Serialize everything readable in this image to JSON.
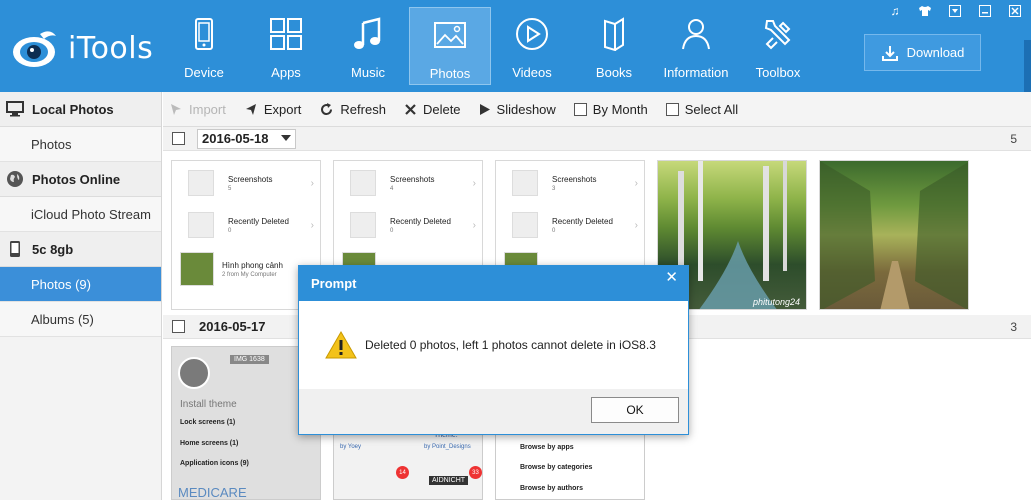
{
  "app": {
    "name": "iTools"
  },
  "nav": [
    {
      "label": "Device",
      "icon": "phone-icon"
    },
    {
      "label": "Apps",
      "icon": "apps-grid-icon"
    },
    {
      "label": "Music",
      "icon": "music-note-icon"
    },
    {
      "label": "Photos",
      "icon": "photo-icon",
      "active": true
    },
    {
      "label": "Videos",
      "icon": "play-circle-icon"
    },
    {
      "label": "Books",
      "icon": "book-icon"
    },
    {
      "label": "Information",
      "icon": "person-icon"
    },
    {
      "label": "Toolbox",
      "icon": "wrench-icon"
    }
  ],
  "header": {
    "download_label": "Download"
  },
  "sidebar": {
    "local_photos": "Local Photos",
    "photos": "Photos",
    "photos_online": "Photos Online",
    "icloud": "iCloud Photo Stream",
    "device": "5c 8gb",
    "device_photos": "Photos (9)",
    "albums": "Albums (5)"
  },
  "toolbar": {
    "import": "Import",
    "export": "Export",
    "refresh": "Refresh",
    "delete": "Delete",
    "slideshow": "Slideshow",
    "by_month": "By Month",
    "select_all": "Select All"
  },
  "groups": [
    {
      "date": "2016-05-18",
      "count": "5"
    },
    {
      "date": "2016-05-17",
      "count": "3"
    }
  ],
  "thumbs": {
    "screenshots": "Screenshots",
    "recently_deleted": "Recently Deleted",
    "counts": [
      "5",
      "4",
      "3"
    ],
    "deleted_count": "0",
    "album_name": "Hình phong cảnh",
    "album_sub": "2 from My Computer",
    "watermark": "phitutong24",
    "tall1_header": "IMG 1638",
    "tall1_install": "Install theme",
    "tall1_lock": "Lock screens (1)",
    "tall1_home": "Home screens (1)",
    "tall1_appicons": "Application icons (9)",
    "tall1_footer": "MEDICARE",
    "tall2_by": "by Yoey",
    "tall2_theme": "Theme.",
    "tall2_by2": "by Point_Designs",
    "badge1": "14",
    "badge2": "33",
    "tall2_word": "AIDNICHT",
    "tall3_apps": "Browse by apps",
    "tall3_cats": "Browse by categories",
    "tall3_authors": "Browse by authors"
  },
  "dialog": {
    "title": "Prompt",
    "message": "Deleted 0 photos, left 1 photos cannot delete in iOS8.3",
    "ok": "OK"
  },
  "colors": {
    "brand": "#2d8fd8",
    "active_side": "#3b8fd9"
  }
}
